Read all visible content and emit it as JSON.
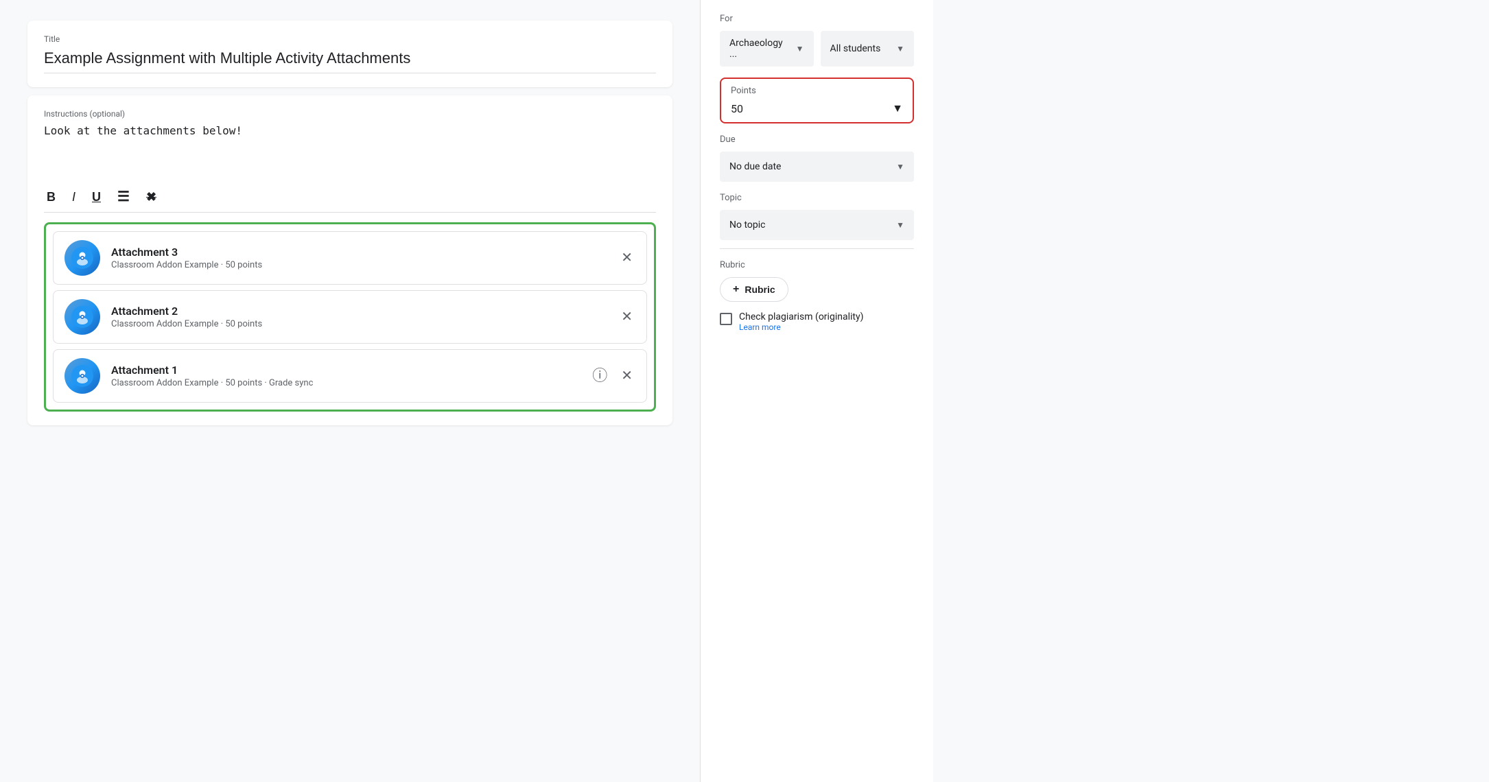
{
  "left": {
    "title_label": "Title",
    "title_value": "Example Assignment with Multiple Activity Attachments",
    "instructions_label": "Instructions (optional)",
    "instructions_value": "Look at the attachments below!",
    "toolbar": {
      "bold": "B",
      "italic": "I",
      "underline": "U",
      "list": "≡",
      "clear": "✕"
    },
    "attachments": [
      {
        "name": "Attachment 3",
        "sub": "Classroom Addon Example · 50 points",
        "has_info": false
      },
      {
        "name": "Attachment 2",
        "sub": "Classroom Addon Example · 50 points",
        "has_info": false
      },
      {
        "name": "Attachment 1",
        "sub": "Classroom Addon Example · 50 points · Grade sync",
        "has_info": true
      }
    ]
  },
  "right": {
    "for_label": "For",
    "class_value": "Archaeology ...",
    "students_value": "All students",
    "points_label": "Points",
    "points_value": "50",
    "due_label": "Due",
    "due_value": "No due date",
    "topic_label": "Topic",
    "topic_value": "No topic",
    "rubric_label": "Rubric",
    "rubric_btn": "Rubric",
    "plagiarism_label": "Check plagiarism (originality)",
    "learn_more": "Learn more"
  }
}
